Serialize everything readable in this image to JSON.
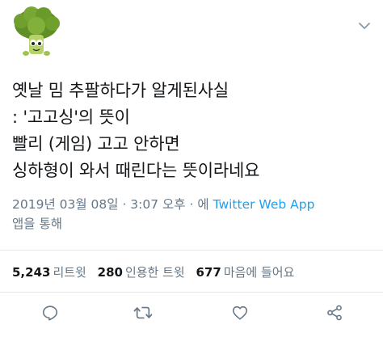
{
  "tweet": {
    "lines": [
      "옛날 밈 추팔하다가 알게된사실",
      ": '고고싱'의 뜻이",
      "빨리 (게임) 고고 안하면",
      "싱하형이 와서 때린다는 뜻이라네요"
    ]
  },
  "meta": {
    "timestamp": "2019년 03월 08일 · 3:07 오후 · 에",
    "app": "Twitter Web App",
    "via_suffix": "앱을 통해"
  },
  "stats": {
    "retweets_count": "5,243",
    "retweets_label": "리트윗",
    "quotes_count": "280",
    "quotes_label": "인용한 트윗",
    "likes_count": "677",
    "likes_label": "마음에 들어요"
  },
  "icons": {
    "avatar": "broccoli-avatar",
    "menu": "chevron-down-icon",
    "reply": "reply-icon",
    "retweet": "retweet-icon",
    "like": "heart-icon",
    "share": "share-icon"
  },
  "colors": {
    "text": "#14171a",
    "secondary": "#657786",
    "link": "#1da1f2",
    "avatar_green": "#6a9a2a"
  }
}
